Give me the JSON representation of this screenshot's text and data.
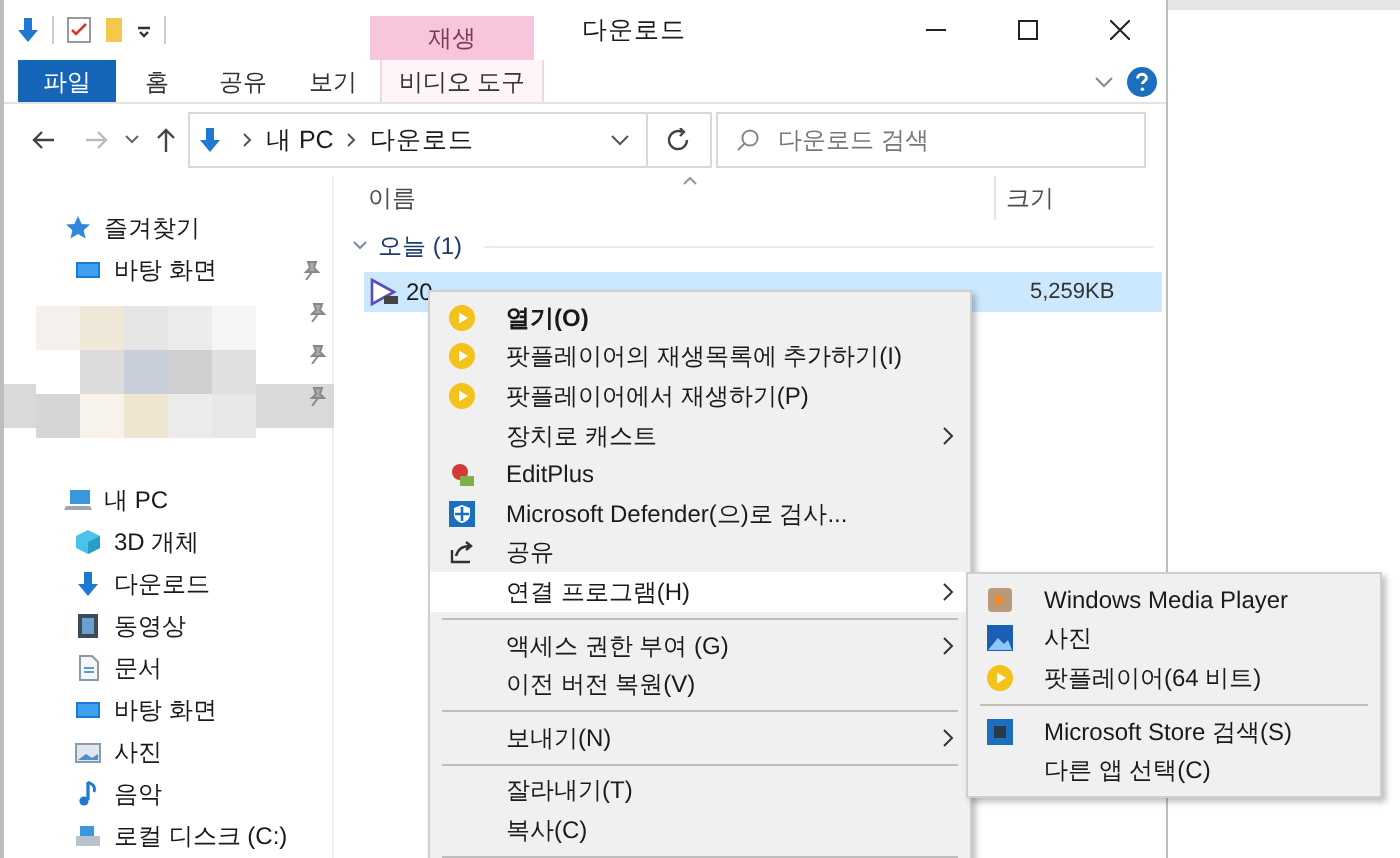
{
  "window": {
    "title": "다운로드",
    "contextual_tab": "재생"
  },
  "ribbon_tabs": [
    {
      "label": "파일",
      "kind": "file"
    },
    {
      "label": "홈",
      "kind": "tab"
    },
    {
      "label": "공유",
      "kind": "tab"
    },
    {
      "label": "보기",
      "kind": "tab"
    },
    {
      "label": "비디오 도구",
      "kind": "contextual"
    }
  ],
  "address": {
    "path": [
      "내 PC",
      "다운로드"
    ],
    "search_placeholder": "다운로드 검색"
  },
  "sidebar": {
    "sections": [
      {
        "label": "즐겨찾기",
        "kind": "star",
        "children": [
          {
            "label": "바탕 화면",
            "kind": "desktop",
            "pinned": true
          }
        ]
      },
      {
        "kind": "obscured"
      },
      {
        "label": "내 PC",
        "kind": "pc",
        "children": [
          {
            "label": "3D 개체",
            "kind": "cube"
          },
          {
            "label": "다운로드",
            "kind": "download"
          },
          {
            "label": "동영상",
            "kind": "video"
          },
          {
            "label": "문서",
            "kind": "document"
          },
          {
            "label": "바탕 화면",
            "kind": "desktop"
          },
          {
            "label": "사진"
          },
          {
            "label": "음악",
            "kind": "music"
          },
          {
            "label": "로컬 디스크 (C:)",
            "kind": "disk"
          }
        ]
      }
    ]
  },
  "columns": [
    "이름",
    "크기"
  ],
  "groups": [
    {
      "label": "오늘 (1)",
      "expanded": true,
      "files": [
        {
          "name": "20",
          "size": "5,259KB",
          "selected": true
        }
      ]
    }
  ],
  "context_menu": [
    {
      "kind": "play",
      "label": "열기(O)",
      "default": true
    },
    {
      "kind": "play",
      "label": "팟플레이어의 재생목록에 추가하기(I)",
      "default": false
    },
    {
      "kind": "play",
      "label": "팟플레이어에서 재생하기(P)",
      "default": false
    },
    {
      "kind": "plain",
      "label": "장치로 캐스트",
      "submenu": true
    },
    {
      "kind": "editplus",
      "label": "EditPlus",
      "submenu": false
    },
    {
      "kind": "shield",
      "label": "Microsoft Defender(으)로 검사...",
      "submenu": false
    },
    {
      "kind": "share",
      "label": "공유",
      "submenu": false
    },
    {
      "kind": "plain",
      "label": "연결 프로그램(H)",
      "submenu": true,
      "highlighted": true
    },
    {
      "kind": "separator"
    },
    {
      "kind": "plain",
      "label": "액세스 권한 부여 (G)",
      "submenu": true
    },
    {
      "kind": "plain",
      "label": "이전 버전 복원(V)",
      "submenu": false
    },
    {
      "kind": "separator"
    },
    {
      "kind": "plain",
      "label": "보내기(N)",
      "submenu": true
    },
    {
      "kind": "separator"
    },
    {
      "kind": "plain",
      "label": "잘라내기(T)",
      "submenu": false
    },
    {
      "kind": "plain",
      "label": "복사(C)",
      "submenu": false
    },
    {
      "kind": "separator"
    }
  ],
  "submenu": [
    {
      "kind": "wmp",
      "label": "Windows Media Player"
    },
    {
      "kind": "photos",
      "label": "사진"
    },
    {
      "kind": "play",
      "label": "팟플레이어(64 비트)"
    },
    {
      "kind": "separator"
    },
    {
      "kind": "store",
      "label": "Microsoft Store 검색(S)"
    },
    {
      "kind": "plain",
      "label": "다른 앱 선택(C)"
    }
  ]
}
